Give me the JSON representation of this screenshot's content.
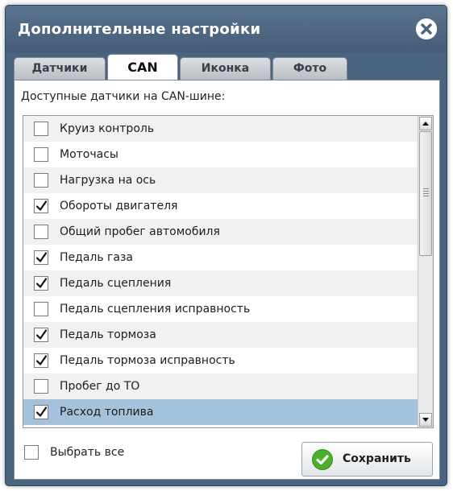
{
  "dialog": {
    "title": "Дополнительные настройки"
  },
  "tabs": [
    {
      "label": "Датчики",
      "active": false
    },
    {
      "label": "CAN",
      "active": true
    },
    {
      "label": "Иконка",
      "active": false
    },
    {
      "label": "Фото",
      "active": false
    }
  ],
  "panel": {
    "subtitle": "Доступные датчики на CAN-шине:"
  },
  "sensors": [
    {
      "label": "Круиз контроль",
      "checked": false
    },
    {
      "label": "Моточасы",
      "checked": false
    },
    {
      "label": "Нагрузка на ось",
      "checked": false
    },
    {
      "label": "Обороты двигателя",
      "checked": true
    },
    {
      "label": "Общий пробег автомобиля",
      "checked": false
    },
    {
      "label": "Педаль газа",
      "checked": true
    },
    {
      "label": "Педаль сцепления",
      "checked": true
    },
    {
      "label": "Педаль сцепления исправность",
      "checked": false
    },
    {
      "label": "Педаль тормоза",
      "checked": true
    },
    {
      "label": "Педаль тормоза исправность",
      "checked": true
    },
    {
      "label": "Пробег до ТО",
      "checked": false
    },
    {
      "label": "Расход топлива",
      "checked": true,
      "selected": true
    }
  ],
  "footer": {
    "select_all_label": "Выбрать все",
    "select_all_checked": false,
    "save_label": "Сохранить"
  },
  "colors": {
    "dialog_frame": "#4a637f",
    "selected_row": "#a5c2dd",
    "save_icon": "#4caf2a"
  },
  "icons": {
    "close": "close-icon",
    "check": "checkmark-icon",
    "save": "check-circle-icon"
  }
}
